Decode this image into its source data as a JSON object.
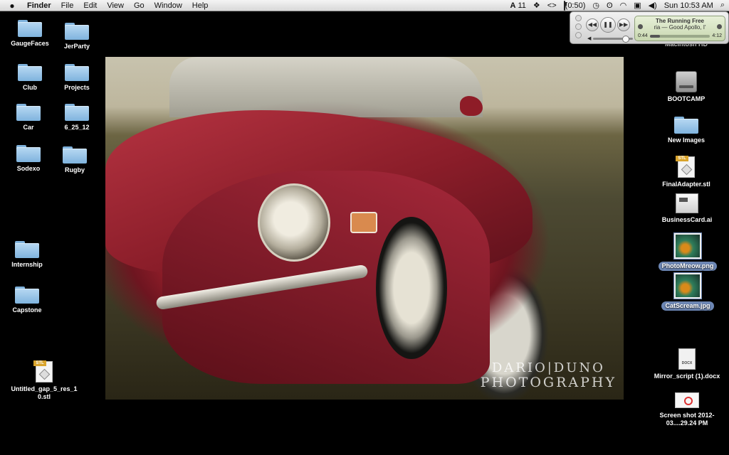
{
  "menubar": {
    "apple": "",
    "items": [
      "Finder",
      "File",
      "Edit",
      "View",
      "Go",
      "Window",
      "Help"
    ],
    "status": {
      "adobe": "11",
      "bluetooth_glyph": "ʘ",
      "code_glyph": "<>",
      "battery": "(0:50)",
      "clock": "Sun 10:53 AM"
    }
  },
  "desktop_left": [
    {
      "label": "GaugeFaces"
    },
    {
      "label": "JerParty"
    },
    {
      "label": "Club"
    },
    {
      "label": "Projects"
    },
    {
      "label": "Car"
    },
    {
      "label": "6_25_12"
    },
    {
      "label": "Sodexo"
    },
    {
      "label": "Rugby"
    },
    {
      "label": "Internship"
    },
    {
      "label": "Capstone"
    },
    {
      "label": "Untitled_gap_5_res_1 0.stl"
    }
  ],
  "desktop_right": [
    {
      "label": "Macintosh HD"
    },
    {
      "label": "BOOTCAMP"
    },
    {
      "label": "New Images"
    },
    {
      "label": "FinalAdapter.stl"
    },
    {
      "label": "BusinessCard.ai"
    },
    {
      "label": "PhotoMreow.png"
    },
    {
      "label": "CatScream.jpg"
    },
    {
      "label": "Mirror_script (1).docx"
    },
    {
      "label": "Screen shot 2012-03....29.24 PM"
    }
  ],
  "stl_tag": "STL",
  "player": {
    "title": "The Running Free",
    "subtitle": "ria — Good Apollo, I'",
    "elapsed": "0:44",
    "remaining": "4:12",
    "progress": 0.17,
    "volume": 0.8,
    "prev": "◀◀",
    "play": "❚❚",
    "next": "▶▶"
  },
  "wallpaper": {
    "watermark_line1": "DARIO|DUNO",
    "watermark_line2": "PHOTOGRAPHY"
  }
}
